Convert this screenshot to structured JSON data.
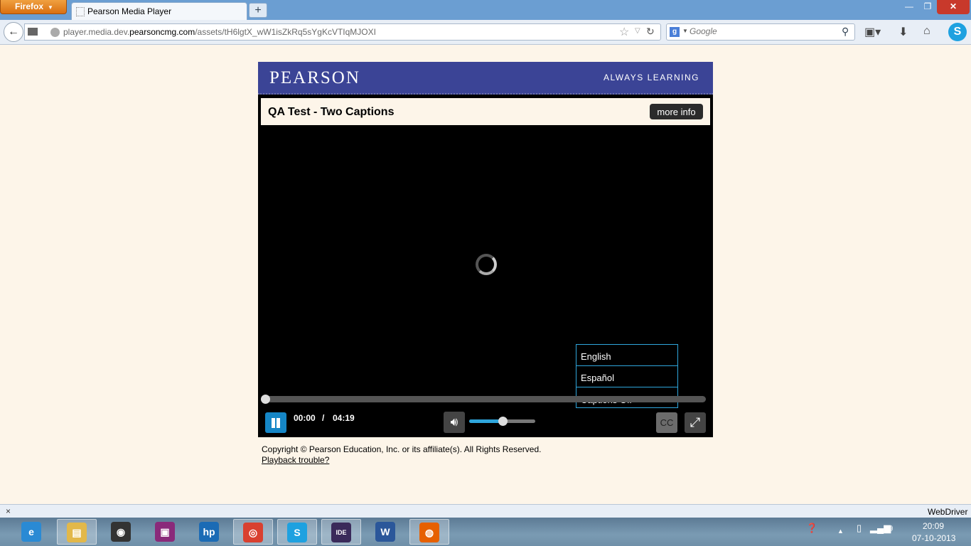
{
  "browser": {
    "menu_label": "Firefox",
    "tab_title": "Pearson Media Player",
    "new_tab": "+",
    "window_controls": {
      "minimize": "—",
      "maximize": "❐",
      "close": "✕"
    },
    "url_prefix": "player.media.dev.",
    "url_domain": "pearsoncmg.com",
    "url_path": "/assets/tH6lgtX_wW1isZkRq5sYgKcVTIqMJOXI",
    "search_placeholder": "Google",
    "status_close": "×",
    "status_text": "WebDriver"
  },
  "player": {
    "brand": "PEARSON",
    "tagline": "ALWAYS LEARNING",
    "title": "QA Test - Two Captions",
    "more_info_label": "more info",
    "captions_menu": [
      {
        "label": "English",
        "selected": false
      },
      {
        "label": "Español",
        "selected": false
      },
      {
        "label": "Captions Off",
        "selected": true
      }
    ],
    "current_time": "00:00",
    "time_separator": "/",
    "duration": "04:19",
    "progress_fraction": 0,
    "volume_fraction": 0.5,
    "cc_label": "CC",
    "accent_color": "#2fa6dc",
    "brand_color": "#3b4496"
  },
  "footer": {
    "copyright": "Copyright © Pearson Education, Inc. or its affiliate(s). All Rights Reserved.",
    "playback_trouble": "Playback trouble?"
  },
  "taskbar": {
    "apps": [
      {
        "name": "internet-explorer",
        "glyph": "e",
        "color": "#2a8ad4"
      },
      {
        "name": "file-explorer",
        "glyph": "▤",
        "color": "#e2b84a"
      },
      {
        "name": "media-player",
        "glyph": "◉",
        "color": "#333333"
      },
      {
        "name": "projector-app",
        "glyph": "▣",
        "color": "#8a2a7a"
      },
      {
        "name": "hp-app",
        "glyph": "hp",
        "color": "#1b6bb5"
      },
      {
        "name": "chrome",
        "glyph": "◎",
        "color": "#d94030"
      },
      {
        "name": "skype",
        "glyph": "S",
        "color": "#1ea1e0"
      },
      {
        "name": "java-ee-ide",
        "glyph": "IDE",
        "color": "#3a2a5a"
      },
      {
        "name": "word",
        "glyph": "W",
        "color": "#2b579a"
      },
      {
        "name": "firefox",
        "glyph": "◍",
        "color": "#e66000"
      }
    ],
    "clock_time": "20:09",
    "clock_date": "07-10-2013"
  }
}
